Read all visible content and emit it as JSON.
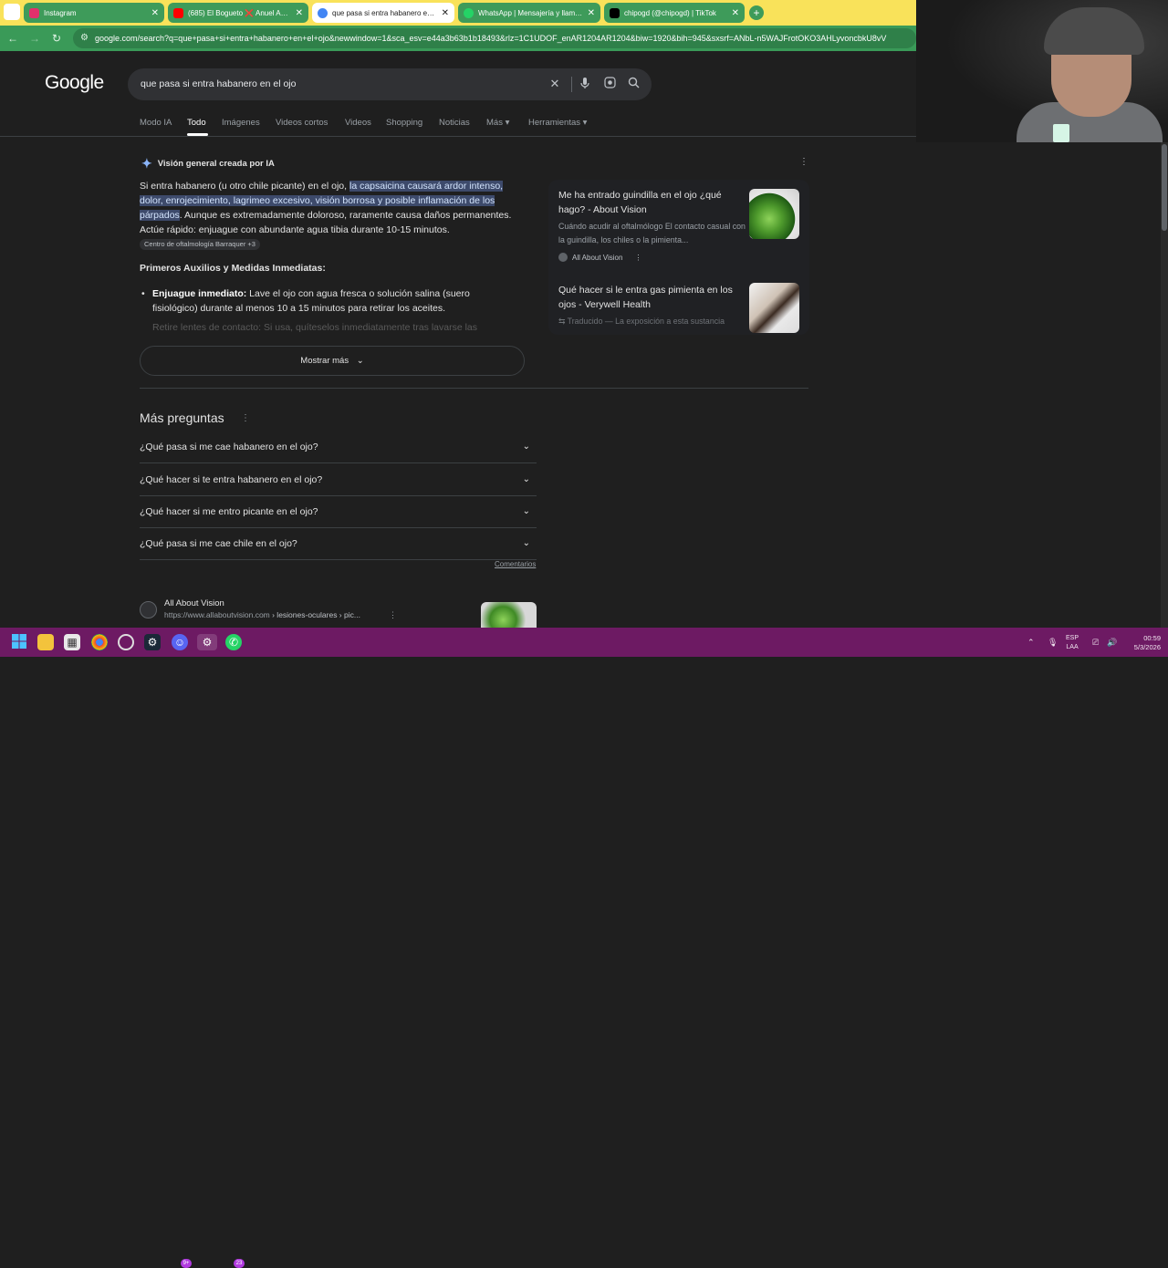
{
  "browser": {
    "tabs": [
      {
        "title": "Instagram",
        "color": "#e1306c"
      },
      {
        "title": "(685) El Bogueto ❌ Anuel AA ...",
        "color": "#ff0000"
      },
      {
        "title": "que pasa si entra habanero en ...",
        "color": "#4285f4"
      },
      {
        "title": "WhatsApp | Mensajería y llama...",
        "color": "#25d366"
      },
      {
        "title": "chipogd (@chipogd) | TikTok",
        "color": "#000000"
      }
    ],
    "new_tab": "+",
    "close": "✕",
    "url": "google.com/search?q=que+pasa+si+entra+habanero+en+el+ojo&newwindow=1&sca_esv=e44a3b63b1b18493&rlz=1C1UDOF_enAR1204AR1204&biw=1920&bih=945&sxsrf=ANbL-n5WAJFrotOKO3AHLyvoncbkU8vV"
  },
  "google": {
    "logo": "Google",
    "query": "que pasa si entra habanero en el ojo",
    "nav": [
      "Modo IA",
      "Todo",
      "Imágenes",
      "Videos cortos",
      "Videos",
      "Shopping",
      "Noticias",
      "Más ▾",
      "Herramientas ▾"
    ],
    "active_nav": "Todo"
  },
  "ai_overview": {
    "header": "Visión general creada por IA",
    "p_start": "Si entra habanero (u otro chile picante) en el ojo, ",
    "p_highlight": "la capsaicina causará ardor intenso, dolor, enrojecimiento, lagrimeo excesivo, visión borrosa y posible inflamación de los párpados",
    "p_end": ". Aunque es extremadamente doloroso, raramente causa daños permanentes. Actúe rápido: enjuague con abundante agua tibia durante 10-15 minutos. ",
    "source_chip": "Centro de oftalmología Barraquer +3",
    "subheading": "Primeros Auxilios y Medidas Inmediatas:",
    "bullet_bold": "Enjuague inmediato:",
    "bullet_text": " Lave el ojo con agua fresca o solución salina (suero fisiológico) durante al menos 10 a 15 minutos para retirar los aceites.",
    "faded": "Retire lentes de contacto: Si usa, quíteselos inmediatamente tras lavarse las",
    "more_button": "Mostrar más"
  },
  "side_cards": [
    {
      "title": "Me ha entrado guindilla en el ojo ¿qué hago? - About Vision",
      "snippet": "Cuándo acudir al oftalmólogo El contacto casual con la guindilla, los chiles o la pimienta...",
      "source": "All About Vision"
    },
    {
      "title": "Qué hacer si le entra gas pimienta en los ojos - Verywell Health",
      "snippet": "Traducido — La exposición a esta sustancia"
    }
  ],
  "paa": {
    "heading": "Más preguntas",
    "questions": [
      "¿Qué pasa si me cae habanero en el ojo?",
      "¿Qué hacer si te entra habanero en el ojo?",
      "¿Qué hacer si me entro picante en el ojo?",
      "¿Qué pasa si me cae chile en el ojo?"
    ],
    "feedback": "Comentarios"
  },
  "result": {
    "site": "All About Vision",
    "url_prefix": "https://www.allaboutvision.com",
    "url_path": " › lesiones-oculares › pic..."
  },
  "taskbar": {
    "lang_line1": "ESP",
    "lang_line2": "LAA",
    "time": "00:59",
    "date": "5/3/2026",
    "badges": [
      "9+",
      "23"
    ]
  },
  "colors": {
    "bg": "#1f1f1f",
    "tabstrip": "#f9e25a",
    "chrome_green": "#3a9a58",
    "taskbar": "#6d1a63",
    "highlight": "#3d4a6b"
  }
}
